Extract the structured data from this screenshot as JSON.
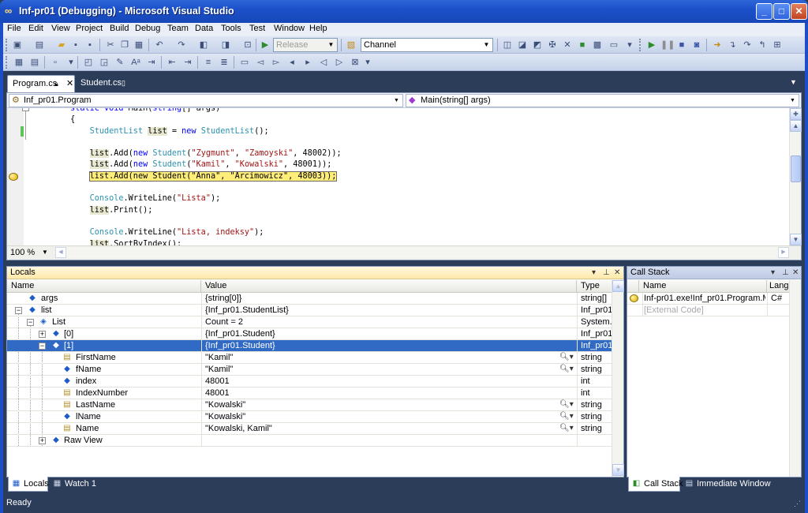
{
  "window": {
    "title": "Inf-pr01 (Debugging) - Microsoft Visual Studio",
    "minimize": "_",
    "maximize": "□",
    "close": "✕",
    "app_icon": "vs-infinity-icon"
  },
  "menu": {
    "items": [
      "File",
      "Edit",
      "View",
      "Project",
      "Build",
      "Debug",
      "Team",
      "Data",
      "Tools",
      "Test",
      "Window",
      "Help"
    ]
  },
  "toolbar": {
    "config_value": "Release",
    "search_value": "Channel"
  },
  "tabs": {
    "active": "Program.cs",
    "inactive": "Student.cs"
  },
  "navbar": {
    "type_value": "Inf_pr01.Program",
    "member_value": "Main(string[] args)"
  },
  "editor": {
    "zoom": "100 %"
  },
  "locals": {
    "title": "Locals",
    "columns": {
      "name": "Name",
      "value": "Value",
      "type": "Type"
    },
    "rows": [
      {
        "name": "args",
        "value": "{string[0]}",
        "type": "string[]"
      },
      {
        "name": "list",
        "value": "{Inf_pr01.StudentList}",
        "type": "Inf_pr01"
      },
      {
        "name": "List",
        "value": "Count = 2",
        "type": "System."
      },
      {
        "name": "[0]",
        "value": "{Inf_pr01.Student}",
        "type": "Inf_pr01"
      },
      {
        "name": "[1]",
        "value": "{Inf_pr01.Student}",
        "type": "Inf_pr01"
      },
      {
        "name": "FirstName",
        "value": "\"Kamil\"",
        "type": "string"
      },
      {
        "name": "fName",
        "value": "\"Kamil\"",
        "type": "string"
      },
      {
        "name": "index",
        "value": "48001",
        "type": "int"
      },
      {
        "name": "IndexNumber",
        "value": "48001",
        "type": "int"
      },
      {
        "name": "LastName",
        "value": "\"Kowalski\"",
        "type": "string"
      },
      {
        "name": "lName",
        "value": "\"Kowalski\"",
        "type": "string"
      },
      {
        "name": "Name",
        "value": "\"Kowalski, Kamil\"",
        "type": "string"
      },
      {
        "name": "Raw View",
        "value": "",
        "type": ""
      }
    ]
  },
  "callstack": {
    "title": "Call Stack",
    "columns": {
      "name": "Name",
      "lang": "Langu"
    },
    "rows": [
      {
        "name": "Inf-pr01.exe!Inf_pr01.Program.M",
        "lang": "C#"
      },
      {
        "name": "[External Code]",
        "lang": ""
      }
    ]
  },
  "bottom_tabs": {
    "locals": "Locals",
    "watch": "Watch 1",
    "callstack": "Call Stack",
    "immediate": "Immediate Window"
  },
  "status": {
    "text": "Ready"
  },
  "colors": {
    "title_bar": "#1c50c9",
    "current_line": "#ffed7a",
    "selected_row": "#316ac5"
  }
}
